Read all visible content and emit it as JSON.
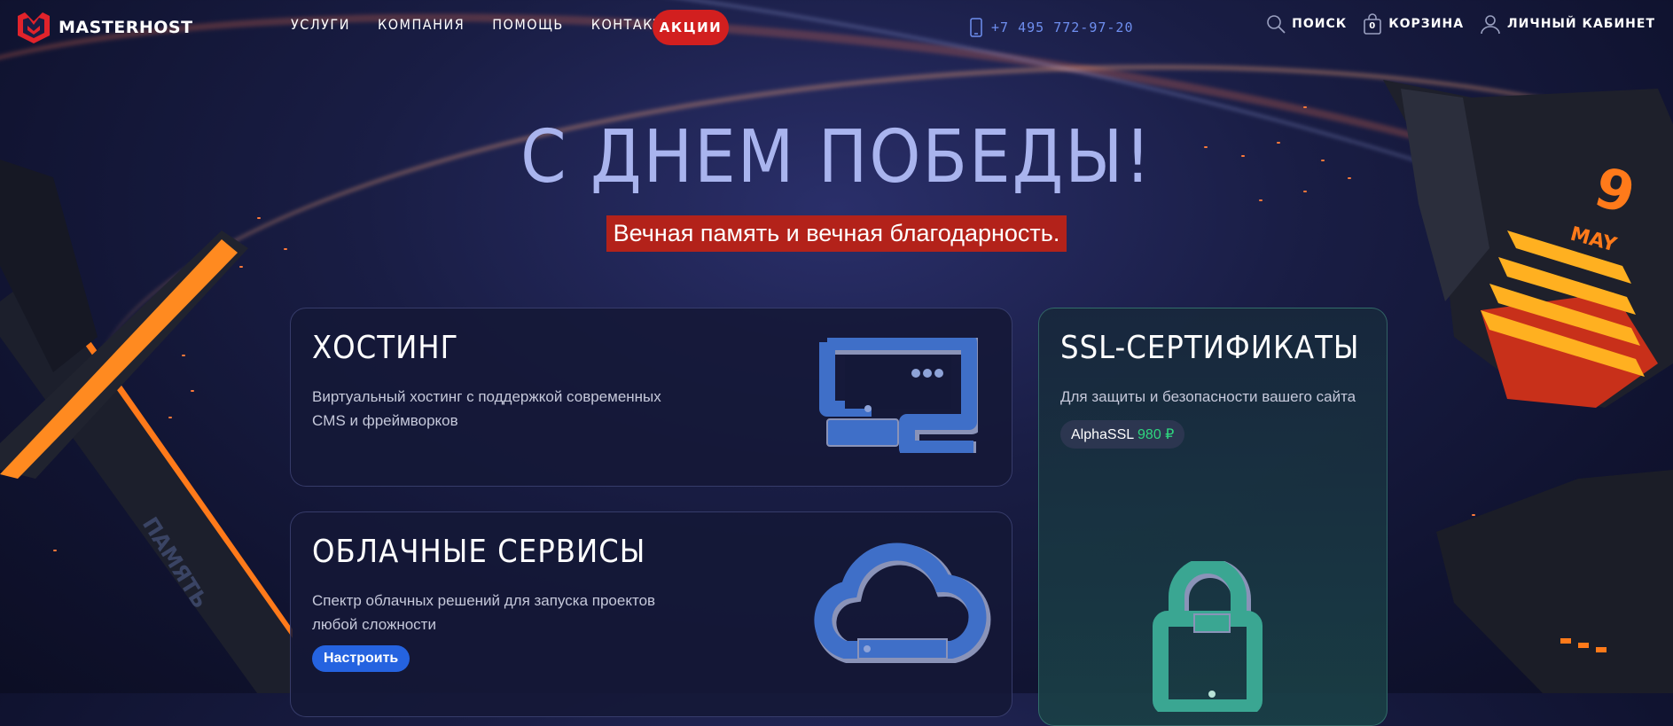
{
  "brand": {
    "name": "MASTERHOST"
  },
  "nav": {
    "items": [
      "УСЛУГИ",
      "КОМПАНИЯ",
      "ПОМОЩЬ",
      "КОНТАКТЫ"
    ],
    "promo": "АКЦИИ"
  },
  "phone": "+7 495 772-97-20",
  "utils": {
    "search": "ПОИСК",
    "cart": "КОРЗИНА",
    "cart_count": "0",
    "account": "ЛИЧНЫЙ КАБИНЕТ"
  },
  "hero": {
    "title": "С ДНЕМ ПОБЕДЫ!",
    "subtitle": "Вечная память и вечная благодарность."
  },
  "decor": {
    "left_label": "ПАМЯТЬ",
    "right_day": "9",
    "right_month": "MAY"
  },
  "cards": {
    "hosting": {
      "title": "ХОСТИНГ",
      "desc": "Виртуальный хостинг с поддержкой современных CMS и фреймворков"
    },
    "cloud": {
      "title": "ОБЛАЧНЫЕ СЕРВИСЫ",
      "desc": "Спектр облачных решений для запуска проектов любой сложности",
      "button": "Настроить"
    },
    "ssl": {
      "title": "SSL-СЕРТИФИКАТЫ",
      "desc": "Для защиты и безопасности вашего сайта",
      "tag_name": "AlphaSSL",
      "tag_price": "980 ₽"
    }
  },
  "colors": {
    "accent_red": "#d21f1f",
    "accent_blue": "#2563e0",
    "price_green": "#2fd57f",
    "phone_blue": "#6f8ff0"
  }
}
